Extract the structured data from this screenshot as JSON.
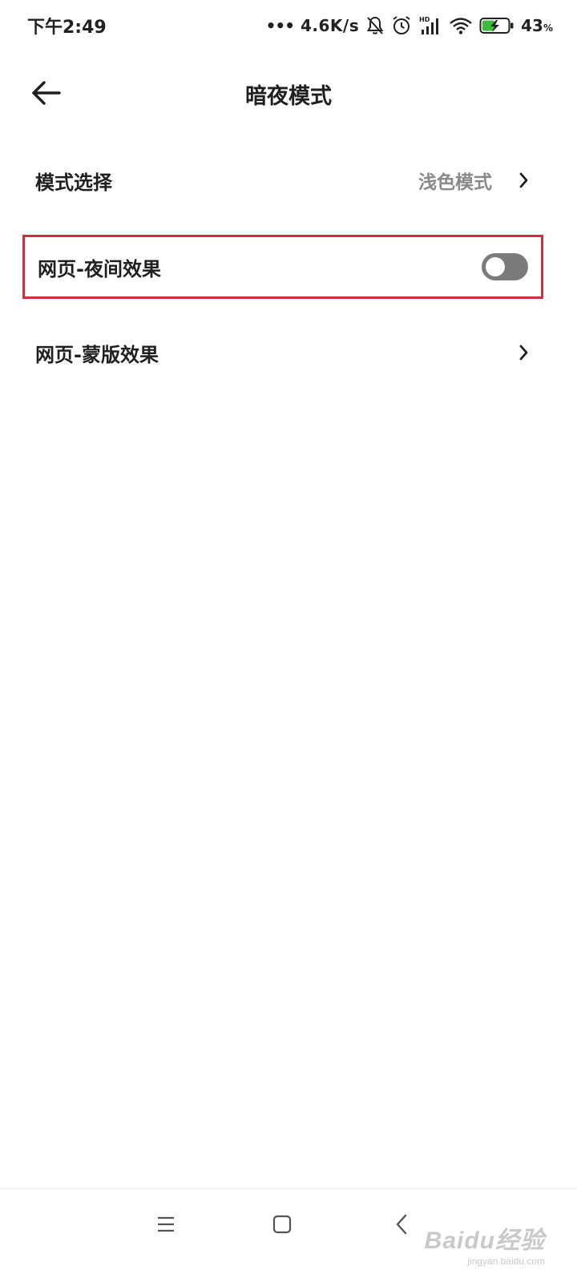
{
  "status_bar": {
    "time": "下午2:49",
    "dots": "•••",
    "speed": "4.6K/s",
    "battery_percent": "43",
    "battery_unit": "%",
    "icons": [
      "bell-off-icon",
      "alarm-icon",
      "hd-signal-icon",
      "wifi-icon",
      "battery-charging-icon"
    ]
  },
  "header": {
    "title": "暗夜模式",
    "back_icon": "arrow-left-icon"
  },
  "settings": {
    "mode_select": {
      "label": "模式选择",
      "value": "浅色模式"
    },
    "web_night": {
      "label": "网页-夜间效果",
      "toggle_on": false
    },
    "web_mask": {
      "label": "网页-蒙版效果"
    }
  },
  "nav": {
    "icons": [
      "menu-icon",
      "home-square-icon",
      "back-chevron-icon"
    ]
  },
  "watermark": {
    "main": "Baidu经验",
    "sub": "jingyan.baidu.com"
  },
  "colors": {
    "highlight_border": "#d0303c",
    "toggle_off": "#7b7b7b",
    "battery_green": "#3dbb3d"
  }
}
